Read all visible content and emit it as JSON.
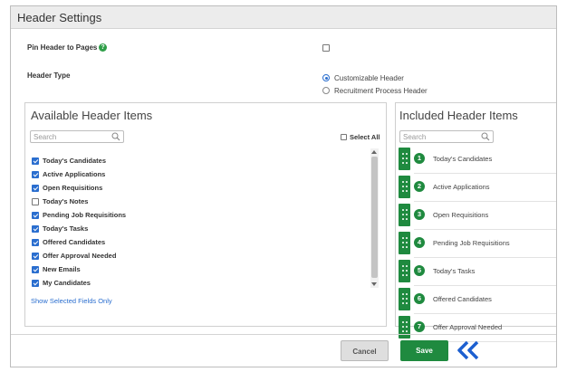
{
  "window": {
    "title": "Header Settings"
  },
  "pin_header": {
    "label": "Pin Header to Pages",
    "help_icon": "help-icon",
    "help_glyph": "?"
  },
  "header_type": {
    "label": "Header Type",
    "options": [
      {
        "label": "Customizable Header",
        "selected": true
      },
      {
        "label": "Recruitment Process Header",
        "selected": false
      }
    ]
  },
  "available": {
    "title": "Available Header Items",
    "search_placeholder": "Search",
    "select_all_label": "Select All",
    "items": [
      {
        "label": "Today's Candidates",
        "checked": true
      },
      {
        "label": "Active Applications",
        "checked": true
      },
      {
        "label": "Open Requisitions",
        "checked": true
      },
      {
        "label": "Today's Notes",
        "checked": false
      },
      {
        "label": "Pending Job Requisitions",
        "checked": true
      },
      {
        "label": "Today's Tasks",
        "checked": true
      },
      {
        "label": "Offered Candidates",
        "checked": true
      },
      {
        "label": "Offer Approval Needed",
        "checked": true
      },
      {
        "label": "New Emails",
        "checked": true
      },
      {
        "label": "My Candidates",
        "checked": true
      }
    ],
    "show_selected_link": "Show Selected Fields Only"
  },
  "included": {
    "title": "Included Header Items",
    "search_placeholder": "Search",
    "items": [
      {
        "num": "1",
        "label": "Today's Candidates"
      },
      {
        "num": "2",
        "label": "Active Applications"
      },
      {
        "num": "3",
        "label": "Open Requisitions"
      },
      {
        "num": "4",
        "label": "Pending Job Requisitions"
      },
      {
        "num": "5",
        "label": "Today's Tasks"
      },
      {
        "num": "6",
        "label": "Offered Candidates"
      },
      {
        "num": "7",
        "label": "Offer Approval Needed"
      }
    ]
  },
  "footer": {
    "cancel_label": "Cancel",
    "save_label": "Save"
  },
  "colors": {
    "accent_green": "#1f8a3f",
    "accent_blue": "#2a6ecf",
    "pointer_blue": "#1c5fd0"
  }
}
